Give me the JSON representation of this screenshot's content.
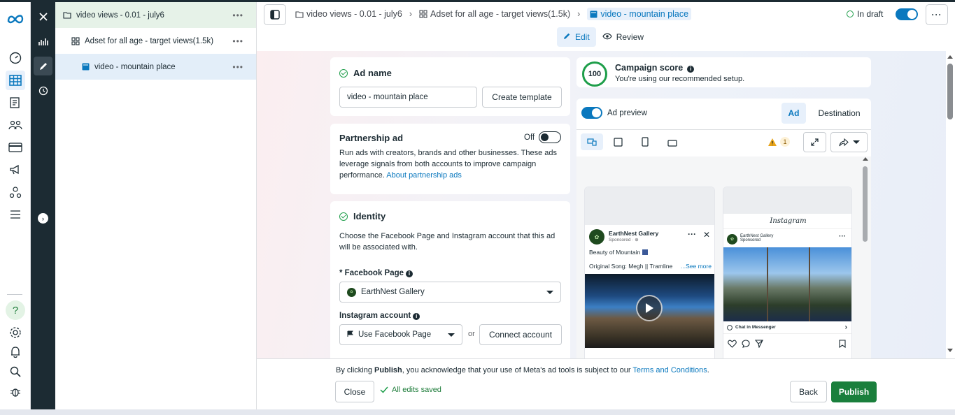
{
  "header": {
    "breadcrumbs": [
      {
        "label": "video views - 0.01 - july6",
        "icon": "folder-icon"
      },
      {
        "label": "Adset for all age - target views(1.5k)",
        "icon": "grid-icon"
      },
      {
        "label": "video - mountain place",
        "icon": "ad-icon"
      }
    ],
    "status": "In draft",
    "tabs": [
      {
        "label": "Edit",
        "icon": "pencil-icon"
      },
      {
        "label": "Review",
        "icon": "eye-icon"
      }
    ]
  },
  "tree": {
    "items": [
      {
        "label": "video views - 0.01 - july6",
        "icon": "folder-icon"
      },
      {
        "label": "Adset for all age - target views(1.5k)",
        "icon": "grid-icon"
      },
      {
        "label": "video - mountain place",
        "icon": "ad-icon"
      }
    ],
    "more": "•••"
  },
  "ad_name": {
    "title": "Ad name",
    "value": "video - mountain place",
    "create_template": "Create template"
  },
  "partnership": {
    "title": "Partnership ad",
    "toggle_label": "Off",
    "description": "Run ads with creators, brands and other businesses. These ads leverage signals from both accounts to improve campaign performance.",
    "link": "About partnership ads"
  },
  "identity": {
    "title": "Identity",
    "description": "Choose the Facebook Page and Instagram account that this ad will be associated with.",
    "facebook_label": "* Facebook Page",
    "facebook_value": "EarthNest Gallery",
    "instagram_label": "Instagram account",
    "instagram_value": "Use Facebook Page",
    "or": "or",
    "connect": "Connect account"
  },
  "campaign_score": {
    "score": "100",
    "title": "Campaign score",
    "subtitle": "You're using our recommended setup."
  },
  "preview": {
    "label": "Ad preview",
    "tab_ad": "Ad",
    "tab_destination": "Destination",
    "warning_count": "1",
    "facebook": {
      "page": "EarthNest Gallery",
      "sponsored": "Sponsored · ⊕",
      "caption": "Beauty of Mountain",
      "song": "Original Song: Megh || Tramline",
      "see_more": "...See more"
    },
    "instagram": {
      "brand": "Instagram",
      "page": "EarthNest Gallery",
      "sponsored": "Sponsored",
      "cta": "Chat in Messenger"
    }
  },
  "footer": {
    "notice_pre": "By clicking ",
    "notice_bold": "Publish",
    "notice_mid": ", you acknowledge that your use of Meta's ad tools is subject to our ",
    "notice_link": "Terms and Conditions",
    "notice_end": ".",
    "close": "Close",
    "saved": "All edits saved",
    "back": "Back",
    "publish": "Publish"
  },
  "colors": {
    "accent": "#0a78be",
    "success": "#1a7f3c",
    "sidebar_dark": "#1c2b33"
  }
}
